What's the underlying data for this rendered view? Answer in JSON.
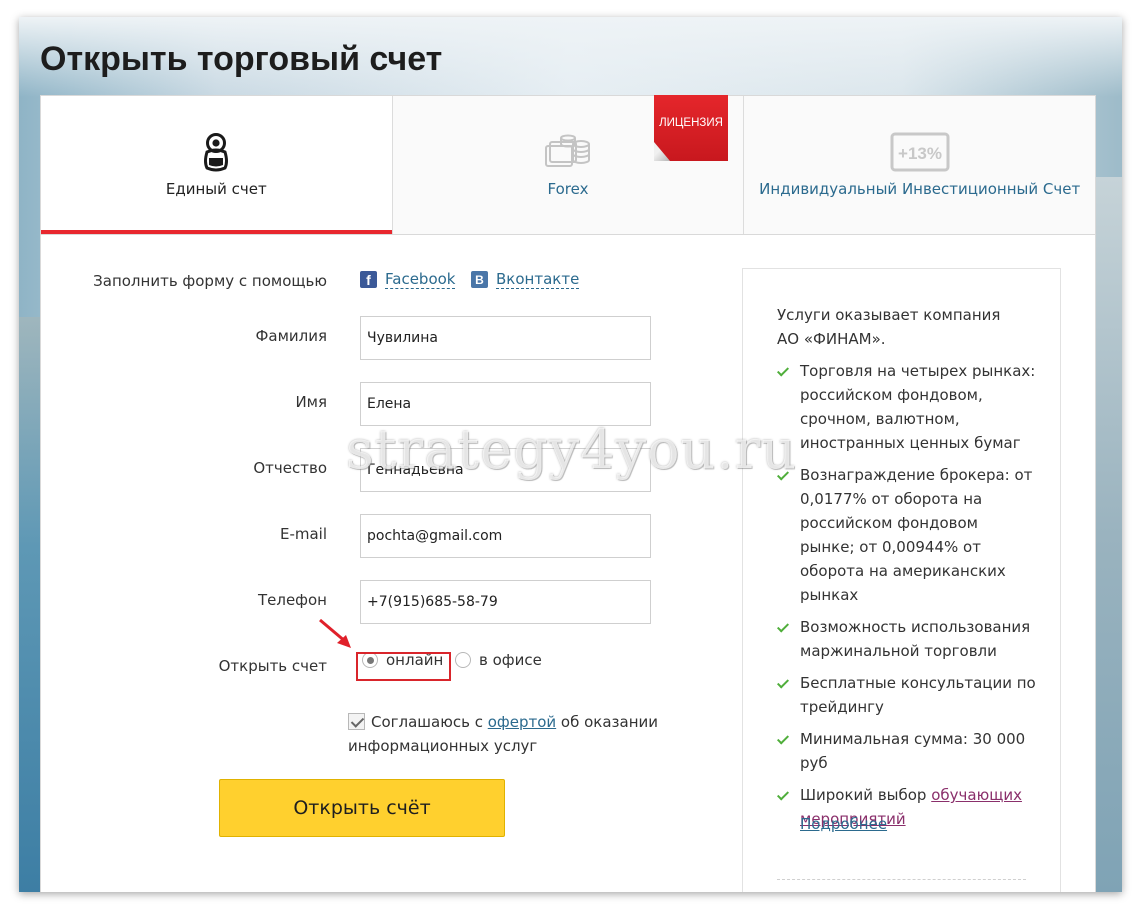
{
  "page": {
    "title": "Открыть торговый счет"
  },
  "tabs": [
    {
      "label": "Единый счет",
      "icon": "matryoshka-icon",
      "active": true
    },
    {
      "label": "Forex",
      "icon": "coins-stack-icon",
      "active": false
    },
    {
      "label": "Индивидуальный Инвестиционный Счет",
      "icon": "plus-13-percent-icon",
      "active": false
    }
  ],
  "ribbon": {
    "label": "ЛИЦЕНЗИЯ"
  },
  "icons": {
    "iis_badge_text": "+13%"
  },
  "form": {
    "social_label": "Заполнить форму с помощью",
    "facebook_label": "Facebook",
    "vkontakte_label": "Вконтакте",
    "fields": {
      "surname": {
        "label": "Фамилия",
        "value": "Чувилина"
      },
      "name": {
        "label": "Имя",
        "value": "Елена"
      },
      "patronymic": {
        "label": "Отчество",
        "value": "Геннадьевна"
      },
      "email": {
        "label": "E-mail",
        "value": "pochta@gmail.com"
      },
      "phone": {
        "label": "Телефон",
        "value": "+7(915)685-58-79"
      }
    },
    "open_account": {
      "label": "Открыть счет",
      "options": [
        "онлайн",
        "в офисе"
      ],
      "selected": "онлайн"
    },
    "agree": {
      "checked": true,
      "text_before": "Соглашаюсь с ",
      "link": "офертой",
      "text_after": " об оказании информационных услуг"
    },
    "submit_label": "Открыть счёт"
  },
  "sidebar": {
    "intro": "Услуги оказывает компания АО «ФИНАМ».",
    "items": [
      "Торговля на четырех рынках: российском фондовом, срочном, валютном, иностранных ценных бумаг",
      "Вознаграждение брокера: от 0,0177% от оборота на российском фондовом рынке; от 0,00944% от оборота на американских рынках",
      "Возможность использования маржинальной торговли",
      "Бесплатные консультации по трейдингу",
      "Минимальная сумма: 30 000 руб"
    ],
    "last_item_text": "Широкий выбор ",
    "last_item_link": "обучающих мероприятий",
    "more_link": "Подробнее"
  },
  "watermark": "strategy4you.ru",
  "colors": {
    "accent_red": "#e8272e",
    "link_blue": "#2b6a8e",
    "button_yellow": "#ffd02e",
    "check_green": "#4fae3a",
    "visited_link": "#8a2f6b"
  }
}
